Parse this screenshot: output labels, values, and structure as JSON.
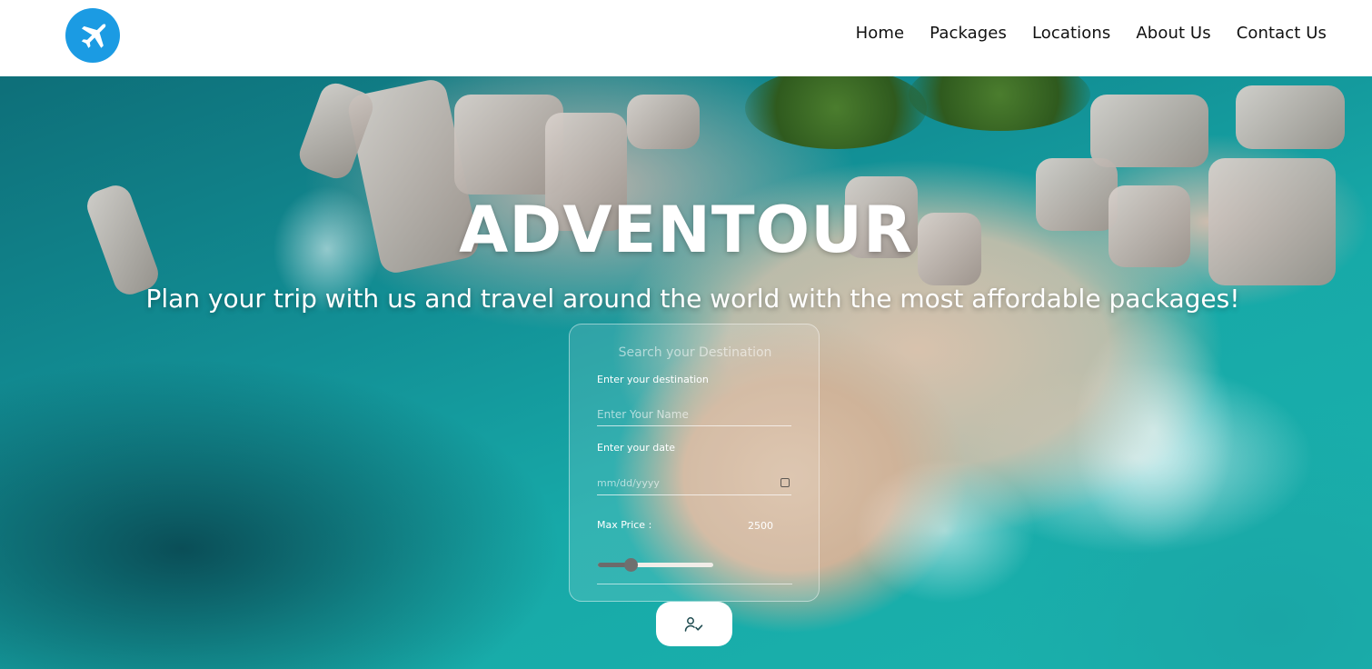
{
  "nav": {
    "logo_icon": "airplane-icon",
    "brand_color": "#1b9be3",
    "links": [
      "Home",
      "Packages",
      "Locations",
      "About Us",
      "Contact Us"
    ]
  },
  "hero": {
    "title": "ADVENTOUR",
    "subtitle": "Plan your trip with us and travel around the world with the most affordable packages!"
  },
  "search_form": {
    "heading": "Search your Destination",
    "destination_label": "Enter your destination",
    "name_placeholder": "Enter Your Name",
    "date_label": "Enter your date",
    "date_placeholder": "mm/dd/yyyy",
    "price_label": "Max Price :",
    "price_value": "2500",
    "slider_fraction": 0.28,
    "submit_icon": "user-check-icon"
  }
}
